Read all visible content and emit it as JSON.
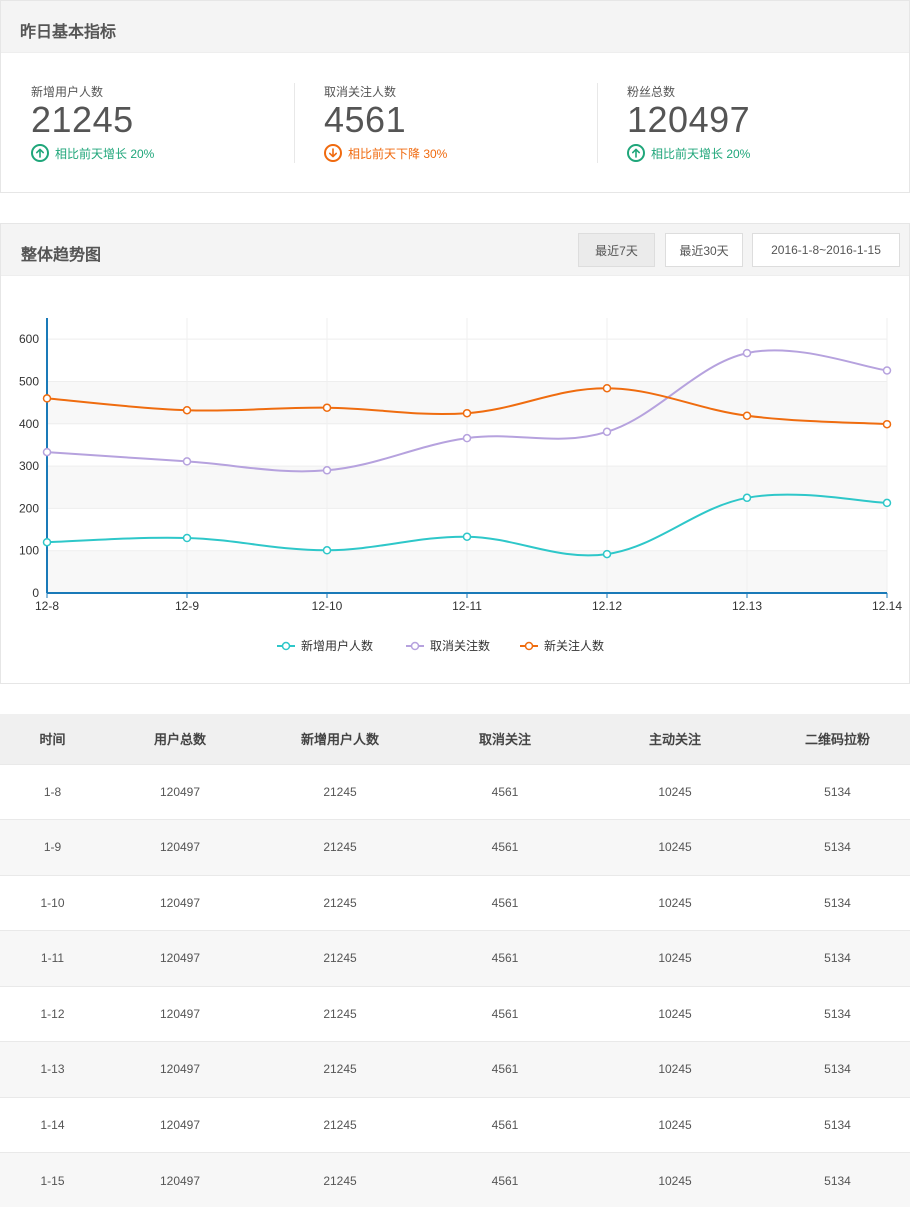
{
  "yesterday": {
    "title": "昨日基本指标",
    "stats": [
      {
        "label": "新增用户人数",
        "value": "21245",
        "change": "相比前天增长 20%",
        "direction": "up"
      },
      {
        "label": "取消关注人数",
        "value": "4561",
        "change": "相比前天下降 30%",
        "direction": "down"
      },
      {
        "label": "粉丝总数",
        "value": "120497",
        "change": "相比前天增长 20%",
        "direction": "up"
      }
    ]
  },
  "trend": {
    "title": "整体趋势图",
    "buttons": {
      "last7": "最近7天",
      "last30": "最近30天",
      "date_range": "2016-1-8~2016-1-15"
    },
    "active_button": "last7"
  },
  "chart_data": {
    "type": "line",
    "x": [
      "12-8",
      "12-9",
      "12-10",
      "12-11",
      "12.12",
      "12.13",
      "12.14"
    ],
    "y_ticks": [
      0,
      100,
      200,
      300,
      400,
      500,
      600
    ],
    "ylim": [
      0,
      650
    ],
    "grid": true,
    "legend_position": "bottom",
    "series": [
      {
        "name": "新增用户人数",
        "color": "#2ec7c9",
        "values": [
          120,
          130,
          101,
          133,
          92,
          225,
          213
        ]
      },
      {
        "name": "取消关注数",
        "color": "#b6a2de",
        "values": [
          333,
          311,
          290,
          366,
          381,
          567,
          526
        ]
      },
      {
        "name": "新关注人数",
        "color": "#ef6c0f",
        "values": [
          460,
          432,
          438,
          425,
          484,
          419,
          399
        ]
      }
    ]
  },
  "table": {
    "headers": [
      "时间",
      "用户总数",
      "新增用户人数",
      "取消关注",
      "主动关注",
      "二维码拉粉"
    ],
    "rows": [
      [
        "1-8",
        "120497",
        "21245",
        "4561",
        "10245",
        "5134"
      ],
      [
        "1-9",
        "120497",
        "21245",
        "4561",
        "10245",
        "5134"
      ],
      [
        "1-10",
        "120497",
        "21245",
        "4561",
        "10245",
        "5134"
      ],
      [
        "1-11",
        "120497",
        "21245",
        "4561",
        "10245",
        "5134"
      ],
      [
        "1-12",
        "120497",
        "21245",
        "4561",
        "10245",
        "5134"
      ],
      [
        "1-13",
        "120497",
        "21245",
        "4561",
        "10245",
        "5134"
      ],
      [
        "1-14",
        "120497",
        "21245",
        "4561",
        "10245",
        "5134"
      ],
      [
        "1-15",
        "120497",
        "21245",
        "4561",
        "10245",
        "5134"
      ]
    ]
  }
}
